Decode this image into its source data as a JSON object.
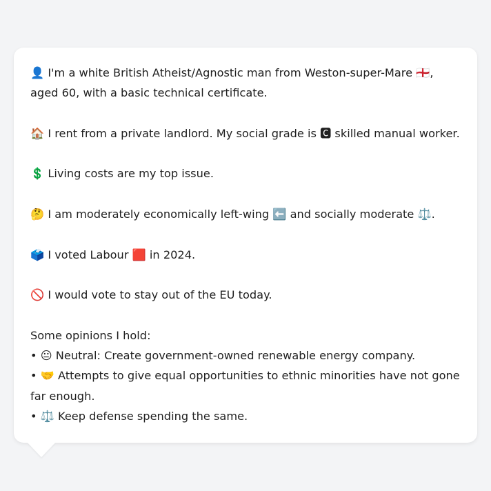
{
  "bubble": {
    "paragraphs": [
      {
        "icon": "👤",
        "text": "I'm a white British Atheist/Agnostic man from Weston-super-Mare 🏴󠁧󠁢󠁥󠁮󠁧󠁿, aged 60, with a basic technical certificate."
      },
      {
        "icon": "🏠",
        "text": "I rent from a private landlord. My social grade is 🅲 skilled manual worker."
      },
      {
        "icon": "💲",
        "text": "Living costs are my top issue."
      },
      {
        "icon": "🤔",
        "text": "I am moderately economically left-wing ⬅️ and socially moderate ⚖️."
      },
      {
        "icon": "🗳️",
        "text": "I voted Labour 🟥 in 2024."
      },
      {
        "icon": "🚫",
        "text": "I would vote to stay out of the EU today."
      }
    ],
    "opinions_heading": "Some opinions I hold:",
    "opinions": [
      {
        "bullet": "•",
        "icon": "😐",
        "text": "Neutral: Create government-owned renewable energy company."
      },
      {
        "bullet": "•",
        "icon": "🤝",
        "text": "Attempts to give equal opportunities to ethnic minorities have not gone far enough."
      },
      {
        "bullet": "•",
        "icon": "⚖️",
        "text": "Keep defense spending the same."
      }
    ]
  }
}
